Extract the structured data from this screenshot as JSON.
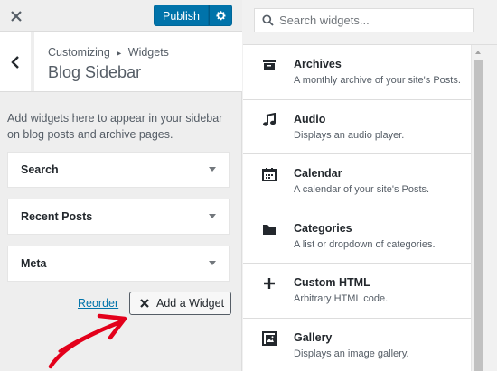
{
  "topbar": {
    "publish_label": "Publish"
  },
  "section": {
    "breadcrumb_parent": "Customizing",
    "breadcrumb_sep": "▸",
    "breadcrumb_child": "Widgets",
    "title": "Blog Sidebar"
  },
  "description": "Add widgets here to appear in your sidebar on blog posts and archive pages.",
  "widgets": [
    {
      "label": "Search"
    },
    {
      "label": "Recent Posts"
    },
    {
      "label": "Meta"
    }
  ],
  "actions": {
    "reorder_label": "Reorder",
    "add_widget_label": "Add a Widget"
  },
  "search": {
    "placeholder": "Search widgets..."
  },
  "available_widgets": [
    {
      "name": "Archives",
      "desc": "A monthly archive of your site's Posts.",
      "icon": "archive-icon"
    },
    {
      "name": "Audio",
      "desc": "Displays an audio player.",
      "icon": "music-note-icon"
    },
    {
      "name": "Calendar",
      "desc": "A calendar of your site's Posts.",
      "icon": "calendar-icon"
    },
    {
      "name": "Categories",
      "desc": "A list or dropdown of categories.",
      "icon": "folder-icon"
    },
    {
      "name": "Custom HTML",
      "desc": "Arbitrary HTML code.",
      "icon": "plus-icon"
    },
    {
      "name": "Gallery",
      "desc": "Displays an image gallery.",
      "icon": "gallery-icon"
    }
  ],
  "colors": {
    "accent": "#0073aa",
    "annotation": "#e3001b"
  }
}
